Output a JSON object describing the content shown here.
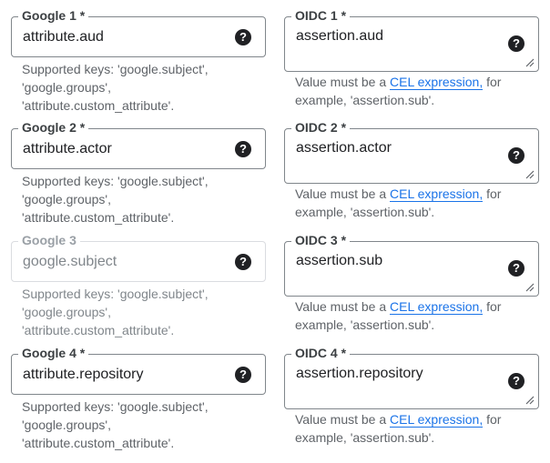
{
  "google_fields": [
    {
      "label": "Google 1 *",
      "value": "attribute.aud",
      "hint_line1": "Supported keys: 'google.subject',",
      "hint_line2": "'google.groups',",
      "hint_line3": "'attribute.custom_attribute'."
    },
    {
      "label": "Google 2 *",
      "value": "attribute.actor",
      "hint_line1": "Supported keys: 'google.subject',",
      "hint_line2": "'google.groups',",
      "hint_line3": "'attribute.custom_attribute'."
    },
    {
      "label": "Google 3",
      "placeholder": "google.subject",
      "hint_line1": "Supported keys: 'google.subject',",
      "hint_line2": "'google.groups',",
      "hint_line3": "'attribute.custom_attribute'."
    },
    {
      "label": "Google 4 *",
      "value": "attribute.repository",
      "hint_line1": "Supported keys: 'google.subject',",
      "hint_line2": "'google.groups',",
      "hint_line3": "'attribute.custom_attribute'."
    }
  ],
  "oidc_fields": [
    {
      "label": "OIDC 1 *",
      "value": "assertion.aud",
      "hint_prefix": "Value must be a ",
      "hint_link": "CEL expression,",
      "hint_suffix": " for",
      "hint_line2": "example, 'assertion.sub'."
    },
    {
      "label": "OIDC 2 *",
      "value": "assertion.actor",
      "hint_prefix": "Value must be a ",
      "hint_link": "CEL expression,",
      "hint_suffix": " for",
      "hint_line2": "example, 'assertion.sub'."
    },
    {
      "label": "OIDC 3 *",
      "value": "assertion.sub",
      "hint_prefix": "Value must be a ",
      "hint_link": "CEL expression,",
      "hint_suffix": " for",
      "hint_line2": "example, 'assertion.sub'."
    },
    {
      "label": "OIDC 4 *",
      "value": "assertion.repository",
      "hint_prefix": "Value must be a ",
      "hint_link": "CEL expression,",
      "hint_suffix": " for",
      "hint_line2": "example, 'assertion.sub'."
    }
  ],
  "help_icon_glyph": "?",
  "help_icon": "help-circle-icon",
  "resize_icon": "textarea-resize-icon",
  "colors": {
    "border": "#80868b",
    "disabled_border": "#dadce0",
    "link": "#1a73e8",
    "hint_text": "#5f6368"
  }
}
